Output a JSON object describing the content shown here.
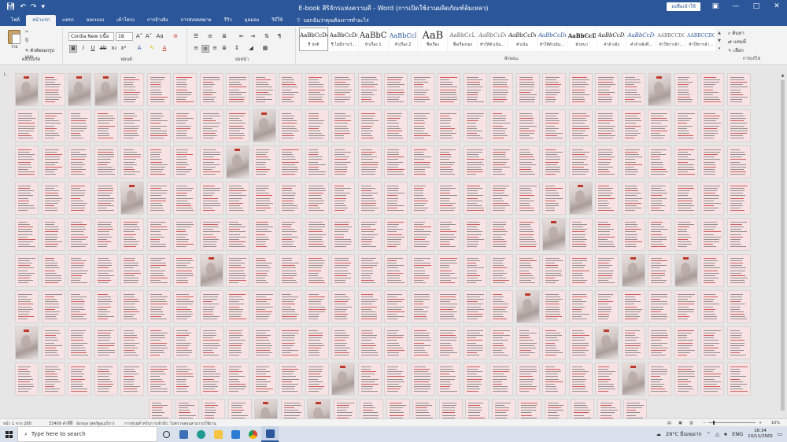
{
  "window": {
    "title": "E-book สิริจักรแห่งความดี - Word (การเปิดใช้งานผลิตภัณฑ์ล้มเหลว)",
    "sign_in": "ลงชื่อเข้าใช้",
    "qat": [
      "save-icon",
      "undo-icon",
      "redo-icon",
      "customize-icon"
    ]
  },
  "tabs": [
    {
      "label": "ไฟล์"
    },
    {
      "label": "หน้าแรก",
      "active": true
    },
    {
      "label": "แทรก"
    },
    {
      "label": "ออกแบบ"
    },
    {
      "label": "เค้าโครง"
    },
    {
      "label": "การอ้างอิง"
    },
    {
      "label": "การส่งจดหมาย"
    },
    {
      "label": "รีวิว"
    },
    {
      "label": "มุมมอง"
    },
    {
      "label": "วิธีใช้"
    }
  ],
  "tell_me": "บอกฉันว่าคุณต้องการทำอะไร",
  "ribbon": {
    "clipboard": {
      "label": "คลิปบอร์ด",
      "paste": "วาง",
      "format_painter": "ตัวคัดลอกรูปแบบ"
    },
    "font": {
      "label": "ฟอนต์",
      "font_name": "Cordia New (เนื้อ",
      "font_size": "18"
    },
    "paragraph": {
      "label": "ย่อหน้า"
    },
    "styles": {
      "label": "ลักษณะ",
      "items": [
        {
          "preview": "AaBbCcDc",
          "name": "¶ ปกติ"
        },
        {
          "preview": "AaBbCcDc",
          "name": "¶ ไม่มีการเว้..."
        },
        {
          "preview": "AaBbC",
          "name": "หัวเรื่อง 1"
        },
        {
          "preview": "AaBbCcl",
          "name": "หัวเรื่อง 2"
        },
        {
          "preview": "AaB",
          "name": "ชื่อเรื่อง"
        },
        {
          "preview": "AaBbCcL",
          "name": "ชื่อเรื่องรอง"
        },
        {
          "preview": "AaBbCcDc",
          "name": "ทำให้ตัวเน้น..."
        },
        {
          "preview": "AaBbCcDc",
          "name": "ตัวเน้น"
        },
        {
          "preview": "AaBbCcDc",
          "name": "ทำให้ตัวเน้น..."
        },
        {
          "preview": "AaBbCcDc",
          "name": "ตัวหนา"
        },
        {
          "preview": "AaBbCcDc",
          "name": "คำอ้างอิง"
        },
        {
          "preview": "AaBbCcDc",
          "name": "คำอ้างอิงที่..."
        },
        {
          "preview": "AABBCCDC",
          "name": "ทำให้การอ้า..."
        },
        {
          "preview": "AABBCCDC",
          "name": "ทำให้การอ้า..."
        }
      ]
    },
    "editing": {
      "label": "การแก้ไข",
      "find": "ค้นหา",
      "replace": "แทนที่",
      "select": "เลือก"
    }
  },
  "status": {
    "page": "หน้า 1 จาก 280",
    "words": "33409 คำ",
    "language": "อังกฤษ (สหรัฐอเมริกา)",
    "accessibility": "การช่วยสำหรับการเข้าถึง: ไปตรวจสอบสามารถใช้งาน",
    "zoom": "10%"
  },
  "taskbar": {
    "search_placeholder": "Type here to search",
    "weather": "29°C มีเมฆมาก",
    "lang": "ENG",
    "time": "16:34",
    "date": "10/11/2565"
  }
}
